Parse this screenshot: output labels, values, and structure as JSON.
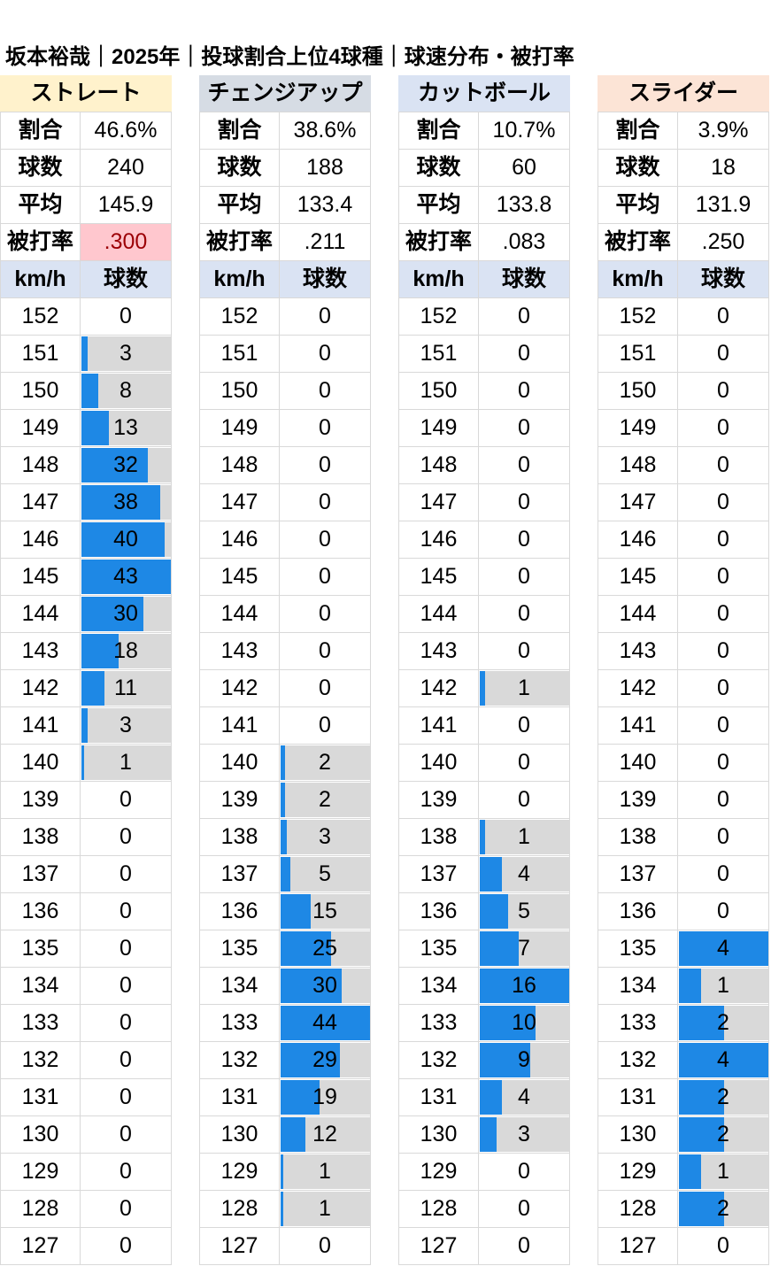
{
  "title": "坂本裕哉｜2025年｜投球割合上位4球種｜球速分布・被打率",
  "labels": {
    "ratio": "割合",
    "count": "球数",
    "avg": "平均",
    "hit_rate": "被打率",
    "speed_col": "km/h",
    "count_col": "球数"
  },
  "colors": {
    "bar": "#1e88e5",
    "bar_track": "#d9d9d9",
    "gridline": "#d9d9d9",
    "distribution_header": "#dae3f3",
    "highlight_hit_rate": "#ffc7ce"
  },
  "chart_data": {
    "type": "table",
    "title": "坂本裕哉｜2025年｜投球割合上位4球種｜球速分布・被打率",
    "speeds": [
      152,
      151,
      150,
      149,
      148,
      147,
      146,
      145,
      144,
      143,
      142,
      141,
      140,
      139,
      138,
      137,
      136,
      135,
      134,
      133,
      132,
      131,
      130,
      129,
      128,
      127
    ],
    "series": [
      {
        "name": "ストレート",
        "header_color": "#fff2cc",
        "ratio": "46.6%",
        "count": "240",
        "avg": "145.9",
        "hit_rate": ".300",
        "hit_rate_highlight": true,
        "counts": [
          0,
          3,
          8,
          13,
          32,
          38,
          40,
          43,
          30,
          18,
          11,
          3,
          1,
          0,
          0,
          0,
          0,
          0,
          0,
          0,
          0,
          0,
          0,
          0,
          0,
          0
        ]
      },
      {
        "name": "チェンジアップ",
        "header_color": "#d6dce4",
        "ratio": "38.6%",
        "count": "188",
        "avg": "133.4",
        "hit_rate": ".211",
        "hit_rate_highlight": false,
        "counts": [
          0,
          0,
          0,
          0,
          0,
          0,
          0,
          0,
          0,
          0,
          0,
          0,
          2,
          2,
          3,
          5,
          15,
          25,
          30,
          44,
          29,
          19,
          12,
          1,
          1,
          0
        ]
      },
      {
        "name": "カットボール",
        "header_color": "#dae3f3",
        "ratio": "10.7%",
        "count": "60",
        "avg": "133.8",
        "hit_rate": ".083",
        "hit_rate_highlight": false,
        "counts": [
          0,
          0,
          0,
          0,
          0,
          0,
          0,
          0,
          0,
          0,
          1,
          0,
          0,
          0,
          1,
          4,
          5,
          7,
          16,
          10,
          9,
          4,
          3,
          0,
          0,
          0
        ]
      },
      {
        "name": "スライダー",
        "header_color": "#fce4d6",
        "ratio": "3.9%",
        "count": "18",
        "avg": "131.9",
        "hit_rate": ".250",
        "hit_rate_highlight": false,
        "counts": [
          0,
          0,
          0,
          0,
          0,
          0,
          0,
          0,
          0,
          0,
          0,
          0,
          0,
          0,
          0,
          0,
          0,
          4,
          1,
          2,
          4,
          2,
          2,
          1,
          2,
          0
        ]
      }
    ]
  }
}
